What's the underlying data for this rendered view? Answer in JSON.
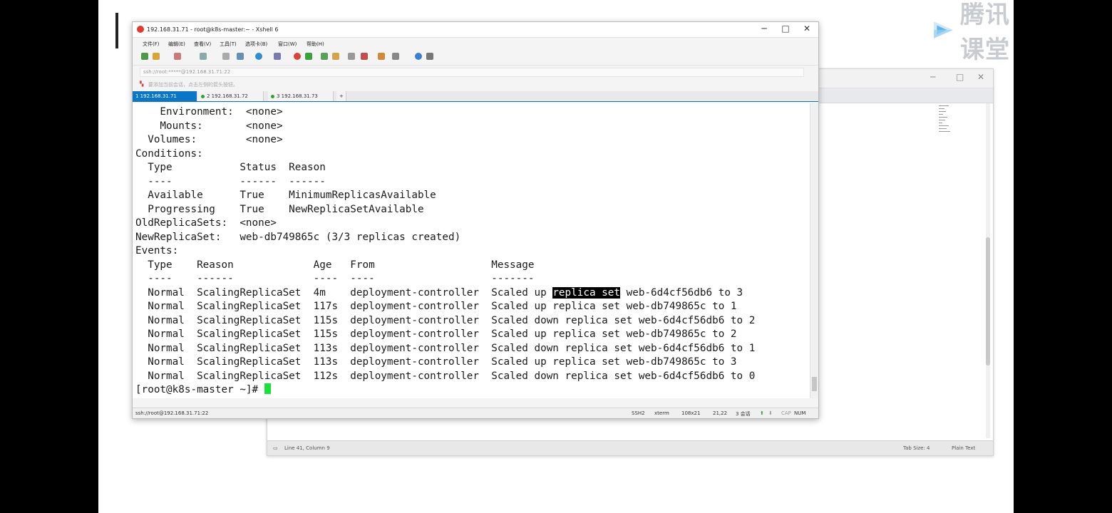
{
  "logo": {
    "text": "腾讯课堂"
  },
  "bg_editor": {
    "status_left": "Line 41, Column 9",
    "tab_size": "Tab Size: 4",
    "syntax": "Plain Text"
  },
  "xshell": {
    "title": "192.168.31.71 - root@k8s-master:~ - Xshell 6",
    "window_controls": {
      "minimize": "─",
      "maximize": "□",
      "close": "✕"
    },
    "menu": [
      "文件(F)",
      "编辑(E)",
      "查看(V)",
      "工具(T)",
      "选项卡(B)",
      "窗口(W)",
      "帮助(H)"
    ],
    "address": "ssh://root:*****@192.168.31.71:22",
    "hint": "要添加当前会话，点击左侧的箭头按钮。",
    "tabs": [
      {
        "label": "1 192.168.31.71",
        "active": true
      },
      {
        "label": "2 192.168.31.72",
        "active": false
      },
      {
        "label": "3 192.168.31.73",
        "active": false
      }
    ],
    "add_tab": "+",
    "terminal": {
      "lines": [
        "    Environment:  <none>",
        "    Mounts:       <none>",
        "  Volumes:        <none>",
        "Conditions:",
        "  Type           Status  Reason",
        "  ----           ------  ------",
        "  Available      True    MinimumReplicasAvailable",
        "  Progressing    True    NewReplicaSetAvailable",
        "OldReplicaSets:  <none>",
        "NewReplicaSet:   web-db749865c (3/3 replicas created)",
        "Events:",
        "  Type    Reason             Age   From                   Message",
        "  ----    ------             ----  ----                   -------"
      ],
      "events": [
        {
          "type": "Normal",
          "reason": "ScalingReplicaSet",
          "age": "4m",
          "from": "deployment-controller",
          "pre": "Scaled up ",
          "sel": "replica set",
          "post": " web-6d4cf56db6 to 3"
        },
        {
          "type": "Normal",
          "reason": "ScalingReplicaSet",
          "age": "117s",
          "from": "deployment-controller",
          "pre": "",
          "sel": "",
          "post": "Scaled up replica set web-db749865c to 1"
        },
        {
          "type": "Normal",
          "reason": "ScalingReplicaSet",
          "age": "115s",
          "from": "deployment-controller",
          "pre": "",
          "sel": "",
          "post": "Scaled down replica set web-6d4cf56db6 to 2"
        },
        {
          "type": "Normal",
          "reason": "ScalingReplicaSet",
          "age": "115s",
          "from": "deployment-controller",
          "pre": "",
          "sel": "",
          "post": "Scaled up replica set web-db749865c to 2"
        },
        {
          "type": "Normal",
          "reason": "ScalingReplicaSet",
          "age": "113s",
          "from": "deployment-controller",
          "pre": "",
          "sel": "",
          "post": "Scaled down replica set web-6d4cf56db6 to 1"
        },
        {
          "type": "Normal",
          "reason": "ScalingReplicaSet",
          "age": "113s",
          "from": "deployment-controller",
          "pre": "",
          "sel": "",
          "post": "Scaled up replica set web-db749865c to 3"
        },
        {
          "type": "Normal",
          "reason": "ScalingReplicaSet",
          "age": "112s",
          "from": "deployment-controller",
          "pre": "",
          "sel": "",
          "post": "Scaled down replica set web-6d4cf56db6 to 0"
        }
      ],
      "prompt": "[root@k8s-master ~]# "
    },
    "status": {
      "connection": "ssh://root@192.168.31.71:22",
      "protocol": "SSH2",
      "term": "xterm",
      "size": "108x21",
      "cursor_pos": "21,22",
      "sessions": "3 会话",
      "cap": "CAP",
      "num": "NUM"
    }
  },
  "colors": {
    "tab_active": "#0a76c7",
    "cursor": "#17e23a",
    "selection": "#000000"
  }
}
